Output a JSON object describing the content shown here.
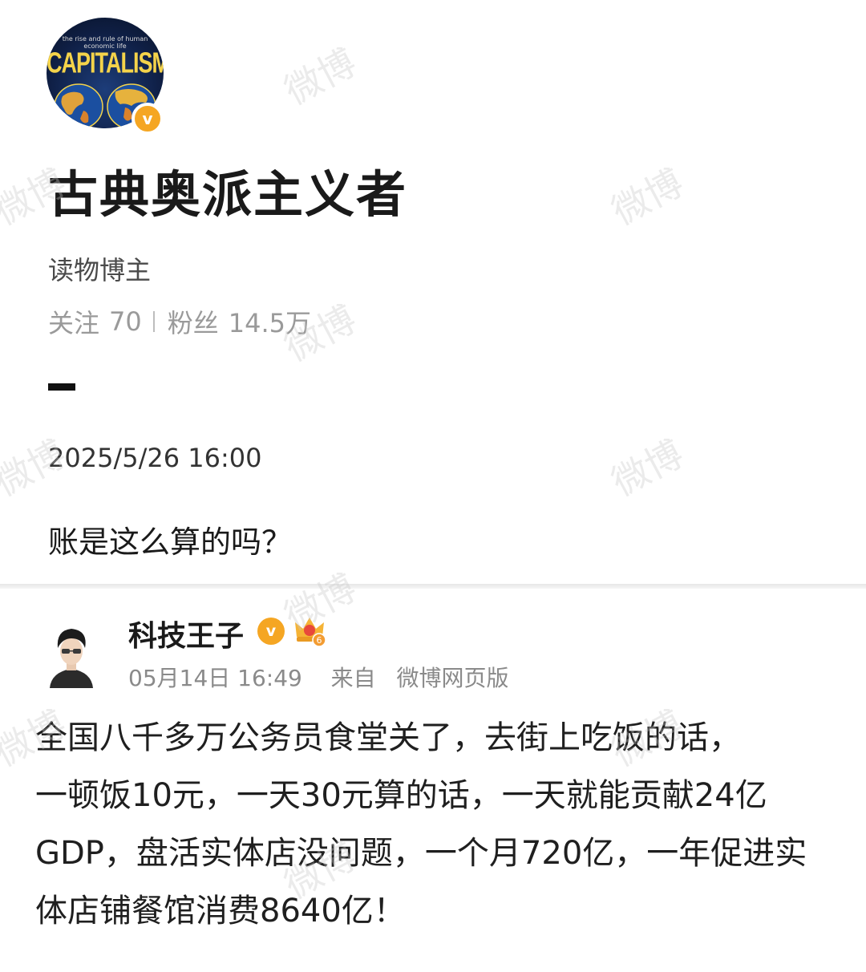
{
  "profile": {
    "avatar_title": "CAPITALISM",
    "avatar_subtitle": "the rise and rule of human economic life",
    "verified_mark": "v",
    "name": "古典奥派主义者",
    "role": "读物博主",
    "stats": {
      "following_label": "关注",
      "following_value": "70",
      "followers_label": "粉丝",
      "followers_value": "14.5万"
    },
    "post_time": "2025/5/26 16:00",
    "post_text": "账是这么算的吗？"
  },
  "quoted": {
    "name": "科技王子",
    "verified_mark": "v",
    "badge_level": "6",
    "date": "05月14日 16:49",
    "source_prefix": "来自",
    "source": "微博网页版",
    "body_lines": [
      "全国八千多万公务员食堂关了，去街上吃饭的话，",
      "一顿饭10元，一天30元算的话，一天就能贡献24亿",
      "GDP，盘活实体店没问题，一个月720亿，一年促进实",
      "体店铺餐馆消费8640亿！"
    ]
  },
  "watermark_text": "微博",
  "colors": {
    "verified": "#f5a623",
    "name_text": "#1a1a1a",
    "secondary_text": "#9a9a9a",
    "divider": "#eeeeee"
  }
}
